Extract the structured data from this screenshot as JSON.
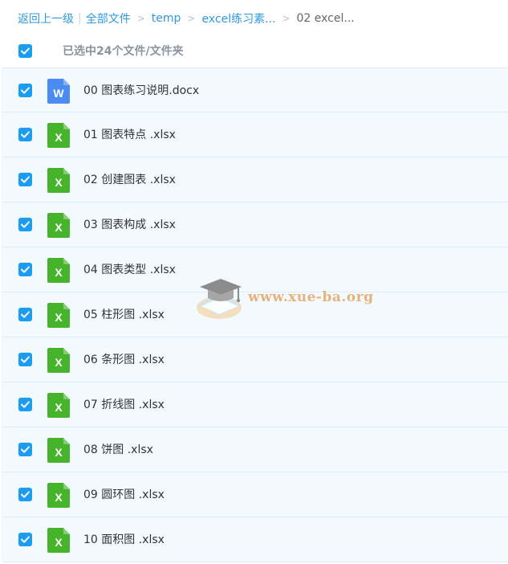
{
  "breadcrumb": {
    "back": "返回上一级",
    "separator_bar": "|",
    "items": [
      "全部文件",
      "temp",
      "excel练习素...",
      "02 excel..."
    ],
    "arrow": ">"
  },
  "header": {
    "selected_text": "已选中24个文件/文件夹",
    "checked": true
  },
  "files": [
    {
      "name": "00 图表练习说明.docx",
      "type": "word",
      "icon_letter": "W"
    },
    {
      "name": "01 图表特点 .xlsx",
      "type": "excel",
      "icon_letter": "X"
    },
    {
      "name": "02 创建图表 .xlsx",
      "type": "excel",
      "icon_letter": "X"
    },
    {
      "name": "03 图表构成 .xlsx",
      "type": "excel",
      "icon_letter": "X"
    },
    {
      "name": "04 图表类型 .xlsx",
      "type": "excel",
      "icon_letter": "X"
    },
    {
      "name": "05 柱形图 .xlsx",
      "type": "excel",
      "icon_letter": "X"
    },
    {
      "name": "06 条形图 .xlsx",
      "type": "excel",
      "icon_letter": "X"
    },
    {
      "name": "07 折线图 .xlsx",
      "type": "excel",
      "icon_letter": "X"
    },
    {
      "name": "08 饼图 .xlsx",
      "type": "excel",
      "icon_letter": "X"
    },
    {
      "name": "09 圆环图 .xlsx",
      "type": "excel",
      "icon_letter": "X"
    },
    {
      "name": "10 面积图 .xlsx",
      "type": "excel",
      "icon_letter": "X"
    }
  ],
  "watermark": {
    "text": "www.xue-ba.org"
  },
  "colors": {
    "accent": "#1a9cf1",
    "link": "#2f9ae0",
    "row_bg": "#f2f9ff",
    "word_icon": "#4a8cf2",
    "excel_icon": "#46b42a",
    "watermark": "#e6b27a"
  }
}
